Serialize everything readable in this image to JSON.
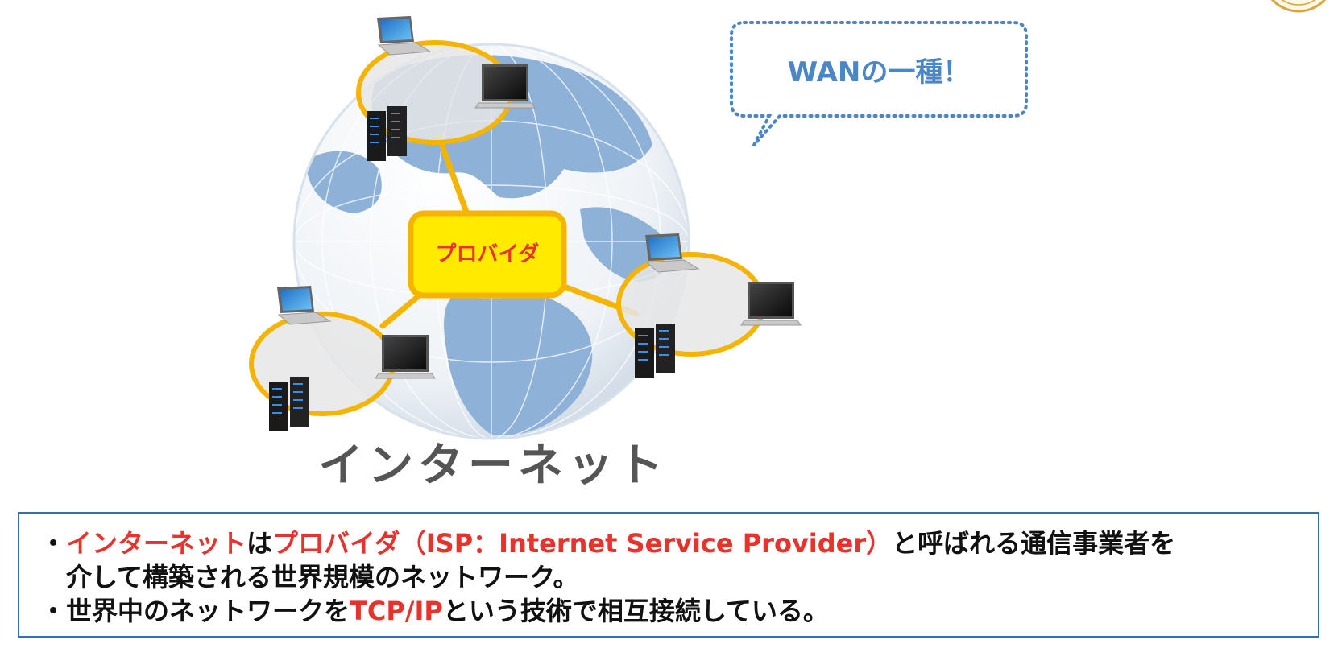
{
  "callout": {
    "text": "WANの一種！"
  },
  "diagram": {
    "hub_label": "プロバイダ",
    "globe_label": "インターネット"
  },
  "notes": {
    "bullet": "・",
    "line1": {
      "a_hl": "インターネット",
      "b": "は",
      "c_hl": "プロバイダ（ISP：Internet Service Provider）",
      "d": "と呼ばれる通信事業者を"
    },
    "line2": "介して構築される世界規模のネットワーク。",
    "line3": {
      "a": "世界中のネットワークを",
      "b_hl": "TCP/IP",
      "c": "という技術で相互接続している。"
    }
  },
  "colors": {
    "accent_red": "#e8322c",
    "callout_blue": "#4a86c8",
    "ring_orange": "#f4b400",
    "hub_yellow": "#ffea00",
    "globe_blue": "#8fb3d9",
    "box_border": "#2f6fb3"
  },
  "icons": [
    "laptop-icon",
    "monitor-icon",
    "server-icon",
    "globe-icon",
    "speech-bubble-icon"
  ]
}
